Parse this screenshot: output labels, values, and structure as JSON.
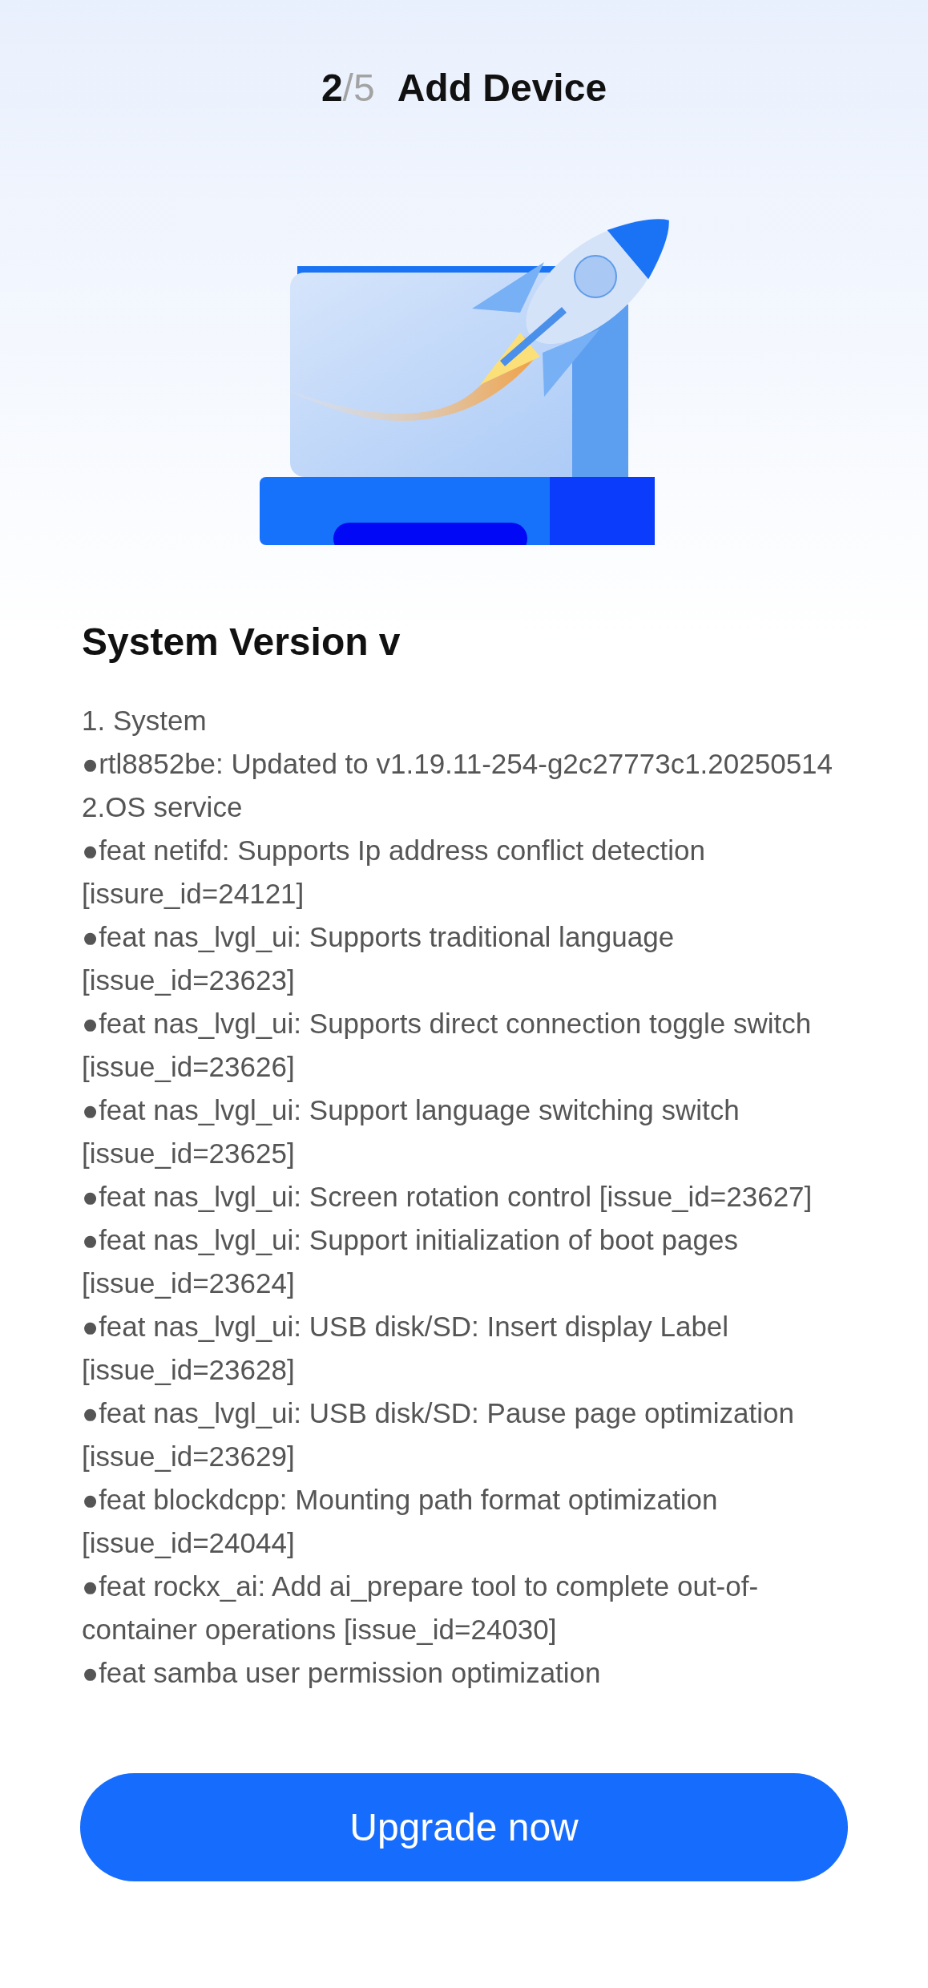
{
  "header": {
    "step_current": "2",
    "step_separator": "/",
    "step_total": "5",
    "title": "Add Device"
  },
  "release_notes": {
    "title": "System Version v",
    "lines": [
      "1. System",
      "●rtl8852be: Updated to v1.19.11-254-g2c27773c1.20250514",
      "2.OS service",
      "●feat netifd: Supports Ip address conflict detection [issure_id=24121]",
      "●feat nas_lvgl_ui: Supports traditional language [issue_id=23623]",
      "●feat nas_lvgl_ui: Supports direct connection toggle switch [issue_id=23626]",
      "●feat nas_lvgl_ui: Support language switching switch [issue_id=23625]",
      "●feat nas_lvgl_ui: Screen rotation control [issue_id=23627]",
      "●feat nas_lvgl_ui: Support initialization of boot pages [issue_id=23624]",
      "●feat nas_lvgl_ui: USB disk/SD: Insert display Label [issue_id=23628]",
      "●feat nas_lvgl_ui: USB disk/SD: Pause page optimization [issue_id=23629]",
      "●feat blockdcpp: Mounting path format optimization [issue_id=24044]",
      "●feat rockx_ai: Add ai_prepare tool to complete out-of-container operations [issue_id=24030]",
      "●feat samba user permission optimization"
    ]
  },
  "primary_button": {
    "label": "Upgrade now"
  }
}
